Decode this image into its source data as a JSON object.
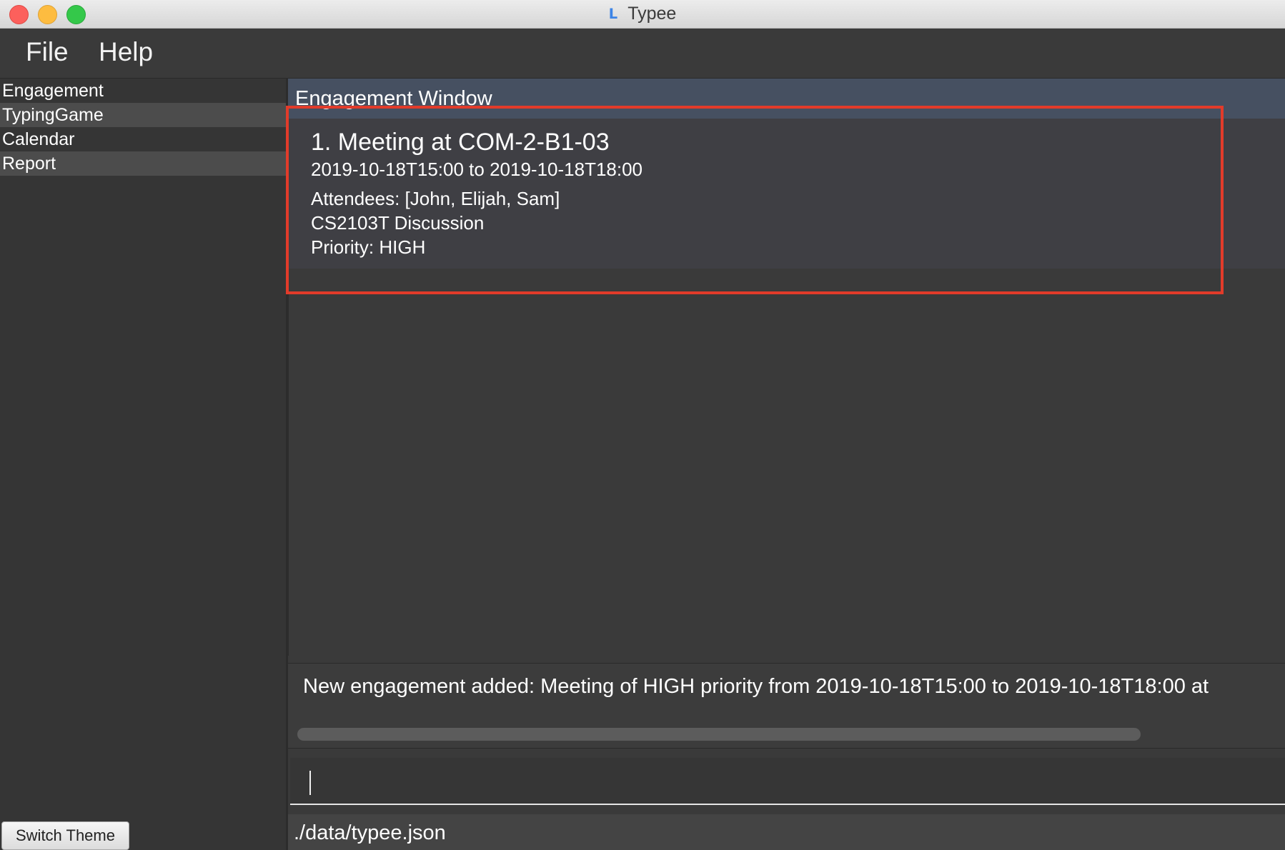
{
  "window": {
    "title": "Typee",
    "icon": "typee-app-icon"
  },
  "menu": {
    "items": [
      "File",
      "Help"
    ]
  },
  "sidebar": {
    "items": [
      "Engagement",
      "TypingGame",
      "Calendar",
      "Report"
    ],
    "switch_theme_label": "Switch Theme"
  },
  "panel": {
    "title": "Engagement Window"
  },
  "engagements": [
    {
      "title": "1. Meeting at COM-2-B1-03",
      "time": "2019-10-18T15:00  to  2019-10-18T18:00",
      "attendees": "Attendees: [John, Elijah, Sam]",
      "description": "CS2103T Discussion",
      "priority": "Priority: HIGH"
    }
  ],
  "result": {
    "text": "New engagement added: Meeting of HIGH priority from 2019-10-18T15:00 to 2019-10-18T18:00 at"
  },
  "command": {
    "value": ""
  },
  "status": {
    "path": "./data/typee.json"
  },
  "colors": {
    "highlight": "#e23b2a",
    "header": "#465061"
  }
}
